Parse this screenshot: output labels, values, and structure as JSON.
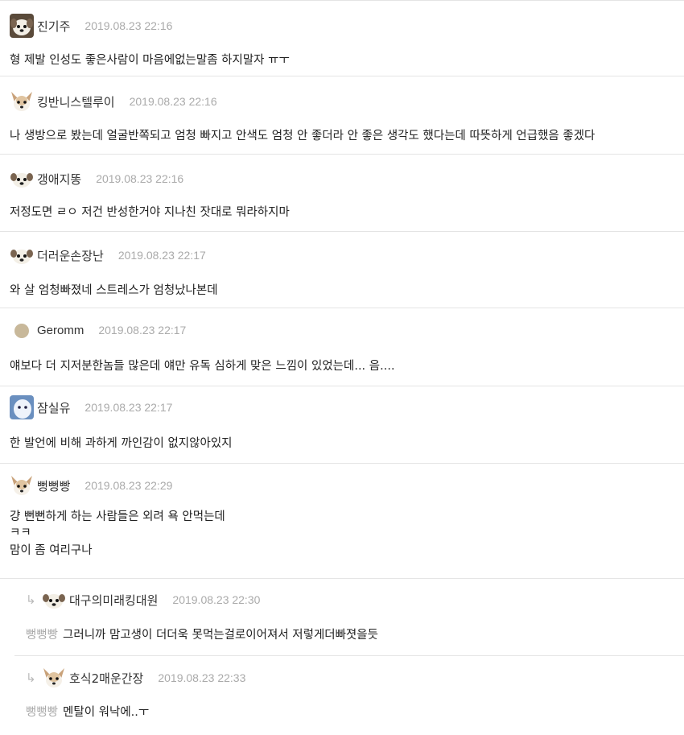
{
  "comments": [
    {
      "nick": "진기주",
      "time": "2019.08.23 22:16",
      "avatar": "dog",
      "lines": [
        "형 제발 인성도 좋은사람이 마음에없는말좀 하지말자 ㅠㅜ"
      ]
    },
    {
      "nick": "킹반니스텔루이",
      "time": "2019.08.23 22:16",
      "avatar": "chihuahua",
      "lines": [
        "나 생방으로 봤는데 얼굴반쪽되고 엄청 빠지고 안색도 엄청 안 좋더라 안 좋은 생각도 했다는데 따뜻하게 언급했음 좋겠다"
      ]
    },
    {
      "nick": "갱애지똥",
      "time": "2019.08.23 22:16",
      "avatar": "dog",
      "lines": [
        "저정도면 ㄹㅇ 저건 반성한거야 지나친 잣대로 뭐라하지마"
      ]
    },
    {
      "nick": "더러운손장난",
      "time": "2019.08.23 22:17",
      "avatar": "dog",
      "lines": [
        "와 살 엄청빠졌네 스트레스가 엄청났나본데"
      ]
    },
    {
      "nick": "Geromm",
      "time": "2019.08.23 22:17",
      "avatar": "circle",
      "lines": [
        "얘보다 더 지저분한놈들 많은데 얘만 유독 심하게 맞은 느낌이 있었는데... 음...."
      ]
    },
    {
      "nick": "잠실유",
      "time": "2019.08.23 22:17",
      "avatar": "ghost",
      "lines": [
        "한 발언에 비해 과하게 까인감이 없지않아있지"
      ]
    },
    {
      "nick": "뻥뻥빵",
      "time": "2019.08.23 22:29",
      "avatar": "chihuahua",
      "lines": [
        "걍 뻔뻔하게 하는 사람들은 외려 욕 안먹는데",
        "ㅋㅋ",
        "맘이 좀 여리구나"
      ]
    }
  ],
  "replies": [
    {
      "arrow": "↳",
      "nick": "대구의미래킹대원",
      "time": "2019.08.23 22:30",
      "avatar": "dog",
      "mention": "뻥뻥빵",
      "text": "그러니까 맘고생이 더더욱 못먹는걸로이어져서 저렇게더빠졋을듯"
    },
    {
      "arrow": "↳",
      "nick": "호식2매운간장",
      "time": "2019.08.23 22:33",
      "avatar": "chihuahua",
      "mention": "뻥뻥빵",
      "text": "멘탈이 워낙에..ㅜ"
    }
  ],
  "colors": {
    "divider": "#e4e4e4",
    "time": "#aaaaaa",
    "mention": "#aaaaaa"
  }
}
